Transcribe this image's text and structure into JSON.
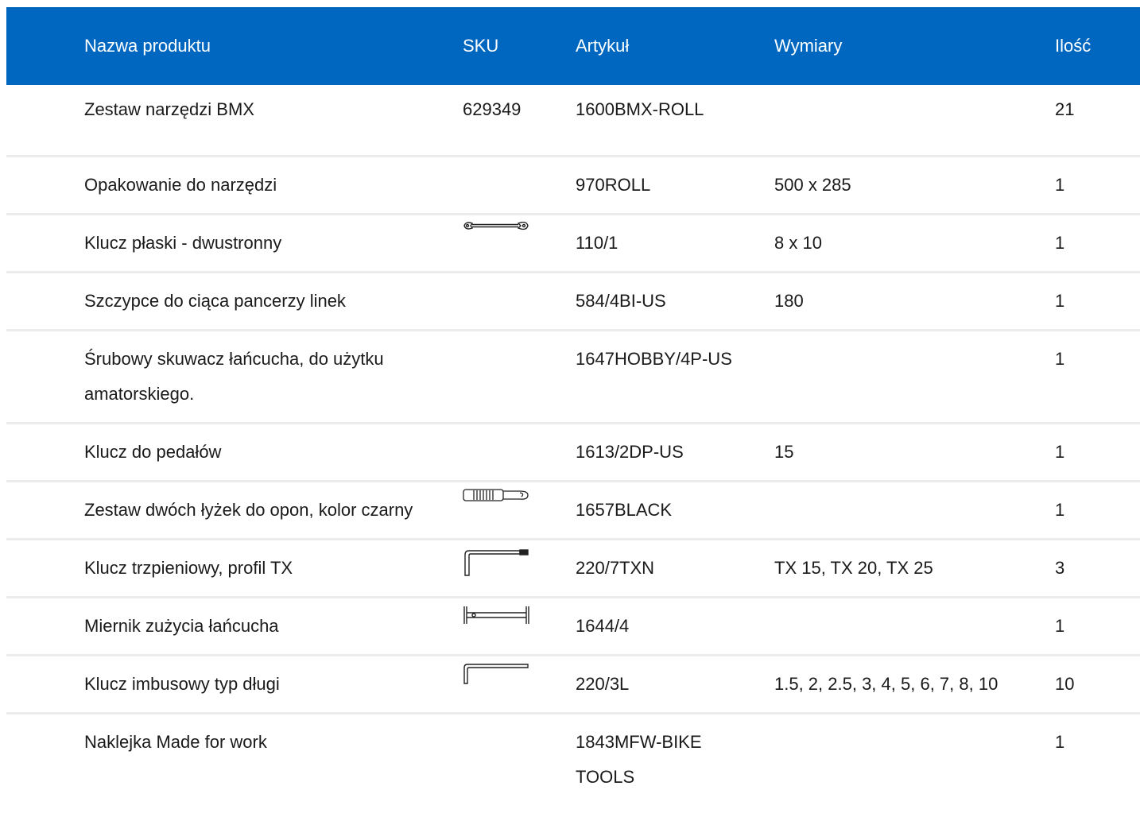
{
  "headers": {
    "name": "Nazwa produktu",
    "sku": "SKU",
    "article": "Artykuł",
    "dimensions": "Wymiary",
    "quantity": "Ilość"
  },
  "rows": [
    {
      "name": "Zestaw narzędzi BMX",
      "sku": "629349",
      "article": "1600BMX-ROLL",
      "dimensions": "",
      "quantity": "21",
      "icon": ""
    },
    {
      "name": "Opakowanie do narzędzi",
      "sku": "",
      "article": "970ROLL",
      "dimensions": "500 x 285",
      "quantity": "1",
      "icon": ""
    },
    {
      "name": "Klucz płaski - dwustronny",
      "sku": "",
      "article": "110/1",
      "dimensions": "8 x 10",
      "quantity": "1",
      "icon": "open-end-wrench-icon"
    },
    {
      "name": "Szczypce do ciąca pancerzy linek",
      "sku": "",
      "article": "584/4BI-US",
      "dimensions": "180",
      "quantity": "1",
      "icon": ""
    },
    {
      "name": "Śrubowy skuwacz łańcucha, do użytku amatorskiego.",
      "sku": "",
      "article": "1647HOBBY/4P-US",
      "dimensions": "",
      "quantity": "1",
      "icon": ""
    },
    {
      "name": "Klucz do pedałów",
      "sku": "",
      "article": "1613/2DP-US",
      "dimensions": "15",
      "quantity": "1",
      "icon": ""
    },
    {
      "name": "Zestaw dwóch łyżek do opon, kolor czarny",
      "sku": "",
      "article": "1657BLACK",
      "dimensions": "",
      "quantity": "1",
      "icon": "tire-lever-icon"
    },
    {
      "name": "Klucz trzpieniowy, profil TX",
      "sku": "",
      "article": "220/7TXN",
      "dimensions": "TX 15, TX 20, TX 25",
      "quantity": "3",
      "icon": "torx-key-icon"
    },
    {
      "name": "Miernik zużycia łańcucha",
      "sku": "",
      "article": "1644/4",
      "dimensions": "",
      "quantity": "1",
      "icon": "chain-wear-gauge-icon"
    },
    {
      "name": "Klucz imbusowy typ długi",
      "sku": "",
      "article": "220/3L",
      "dimensions": "1.5, 2, 2.5, 3, 4, 5, 6, 7, 8, 10",
      "quantity": "10",
      "icon": "hex-key-icon"
    },
    {
      "name": "Naklejka Made for work",
      "sku": "",
      "article": "1843MFW-BIKE TOOLS",
      "dimensions": "",
      "quantity": "1",
      "icon": ""
    }
  ],
  "colors": {
    "header_bg": "#0067c0",
    "header_text": "#ffffff",
    "row_divider": "#ececec",
    "text": "#1a1a1a"
  }
}
